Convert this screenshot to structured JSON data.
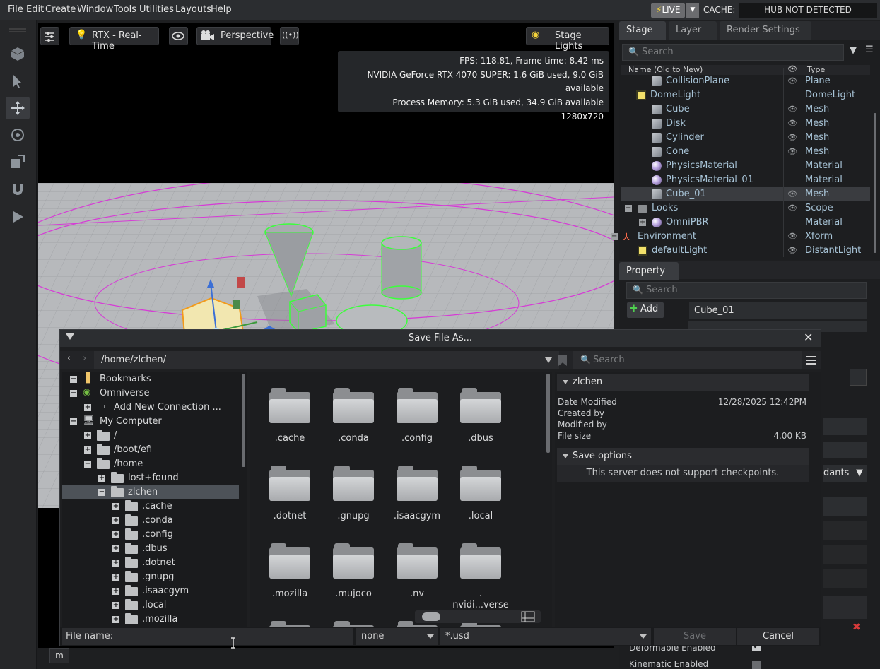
{
  "menubar": {
    "items": [
      "File",
      "Edit",
      "Create",
      "Window",
      "Tools",
      "Utilities",
      "Layouts",
      "Help"
    ],
    "live_label": "LIVE",
    "cache_label": "CACHE:",
    "hub_status": "HUB NOT DETECTED"
  },
  "viewport": {
    "renderer_label": "RTX - Real-Time",
    "camera_label": "Perspective",
    "lights_label": "Stage Lights",
    "stats": [
      "FPS: 118.81, Frame time: 8.42 ms",
      "NVIDIA GeForce RTX 4070 SUPER: 1.6 GiB used, 9.0 GiB available",
      "Process Memory: 5.3 GiB used, 34.9 GiB available",
      "1280x720"
    ],
    "m_button": "m"
  },
  "stage": {
    "tabs": [
      "Stage",
      "Layer",
      "Render Settings"
    ],
    "search_placeholder": "Search",
    "col_name": "Name (Old to New)",
    "col_type": "Type",
    "rows": [
      {
        "name": "CollisionPlane",
        "type": "Plane",
        "icon": "cube"
      },
      {
        "name": "DomeLight",
        "type": "DomeLight",
        "icon": "light"
      },
      {
        "name": "Cube",
        "type": "Mesh",
        "icon": "cube"
      },
      {
        "name": "Disk",
        "type": "Mesh",
        "icon": "cube"
      },
      {
        "name": "Cylinder",
        "type": "Mesh",
        "icon": "cube"
      },
      {
        "name": "Cone",
        "type": "Mesh",
        "icon": "cube"
      },
      {
        "name": "PhysicsMaterial",
        "type": "Material",
        "icon": "sphere"
      },
      {
        "name": "PhysicsMaterial_01",
        "type": "Material",
        "icon": "sphere"
      },
      {
        "name": "Cube_01",
        "type": "Mesh",
        "icon": "cube",
        "selected": true
      },
      {
        "name": "Looks",
        "type": "Scope",
        "icon": "folder"
      },
      {
        "name": "OmniPBR",
        "type": "Material",
        "icon": "sphere"
      },
      {
        "name": "Environment",
        "type": "Xform",
        "icon": "xform"
      },
      {
        "name": "defaultLight",
        "type": "DistantLight",
        "icon": "light"
      }
    ]
  },
  "property": {
    "tab": "Property",
    "search_placeholder": "Search",
    "add_label": "Add",
    "prim_name": "Cube_01",
    "partial_label": "dants",
    "deformable_label": "Deformable Enabled",
    "kinematic_label": "Kinematic Enabled"
  },
  "dialog": {
    "title": "Save File As...",
    "path": "/home/zlchen/",
    "search_placeholder": "Search",
    "tree": [
      {
        "label": "Bookmarks",
        "kind": "bookmark",
        "box": "minus"
      },
      {
        "label": "Omniverse",
        "kind": "omni",
        "box": "minus"
      },
      {
        "label": "Add New Connection ...",
        "kind": "conn",
        "box": "plus"
      },
      {
        "label": "My Computer",
        "kind": "pc",
        "box": "minus"
      },
      {
        "label": "/",
        "kind": "folder",
        "box": "plus"
      },
      {
        "label": "/boot/efi",
        "kind": "folder",
        "box": "plus"
      },
      {
        "label": "/home",
        "kind": "folder",
        "box": "minus"
      },
      {
        "label": "lost+found",
        "kind": "folder",
        "box": "plus"
      },
      {
        "label": "zlchen",
        "kind": "folder",
        "box": "minus",
        "selected": true
      },
      {
        "label": ".cache",
        "kind": "folder",
        "box": "plus"
      },
      {
        "label": ".conda",
        "kind": "folder",
        "box": "plus"
      },
      {
        "label": ".config",
        "kind": "folder",
        "box": "plus"
      },
      {
        "label": ".dbus",
        "kind": "folder",
        "box": "plus"
      },
      {
        "label": ".dotnet",
        "kind": "folder",
        "box": "plus"
      },
      {
        "label": ".gnupg",
        "kind": "folder",
        "box": "plus"
      },
      {
        "label": ".isaacgym",
        "kind": "folder",
        "box": "plus"
      },
      {
        "label": ".local",
        "kind": "folder",
        "box": "plus"
      },
      {
        "label": ".mozilla",
        "kind": "folder",
        "box": "plus"
      }
    ],
    "grid": [
      ".cache",
      ".conda",
      ".config",
      ".dbus",
      ".dotnet",
      ".gnupg",
      ".isaacgym",
      ".local",
      ".mozilla",
      ".mujoco",
      ".nv",
      ".\nnvidi...verse"
    ],
    "info": {
      "folder_name": "zlchen",
      "date_modified_label": "Date Modified",
      "date_modified": "12/28/2025 12:42PM",
      "created_by_label": "Created by",
      "modified_by_label": "Modified by",
      "file_size_label": "File size",
      "file_size": "4.00 KB",
      "save_options_label": "Save options",
      "checkpoint_msg": "This server does not support checkpoints."
    },
    "file_name_label": "File name:",
    "version_option": "none",
    "extension_filter": "*.usd",
    "save_label": "Save",
    "cancel_label": "Cancel"
  }
}
